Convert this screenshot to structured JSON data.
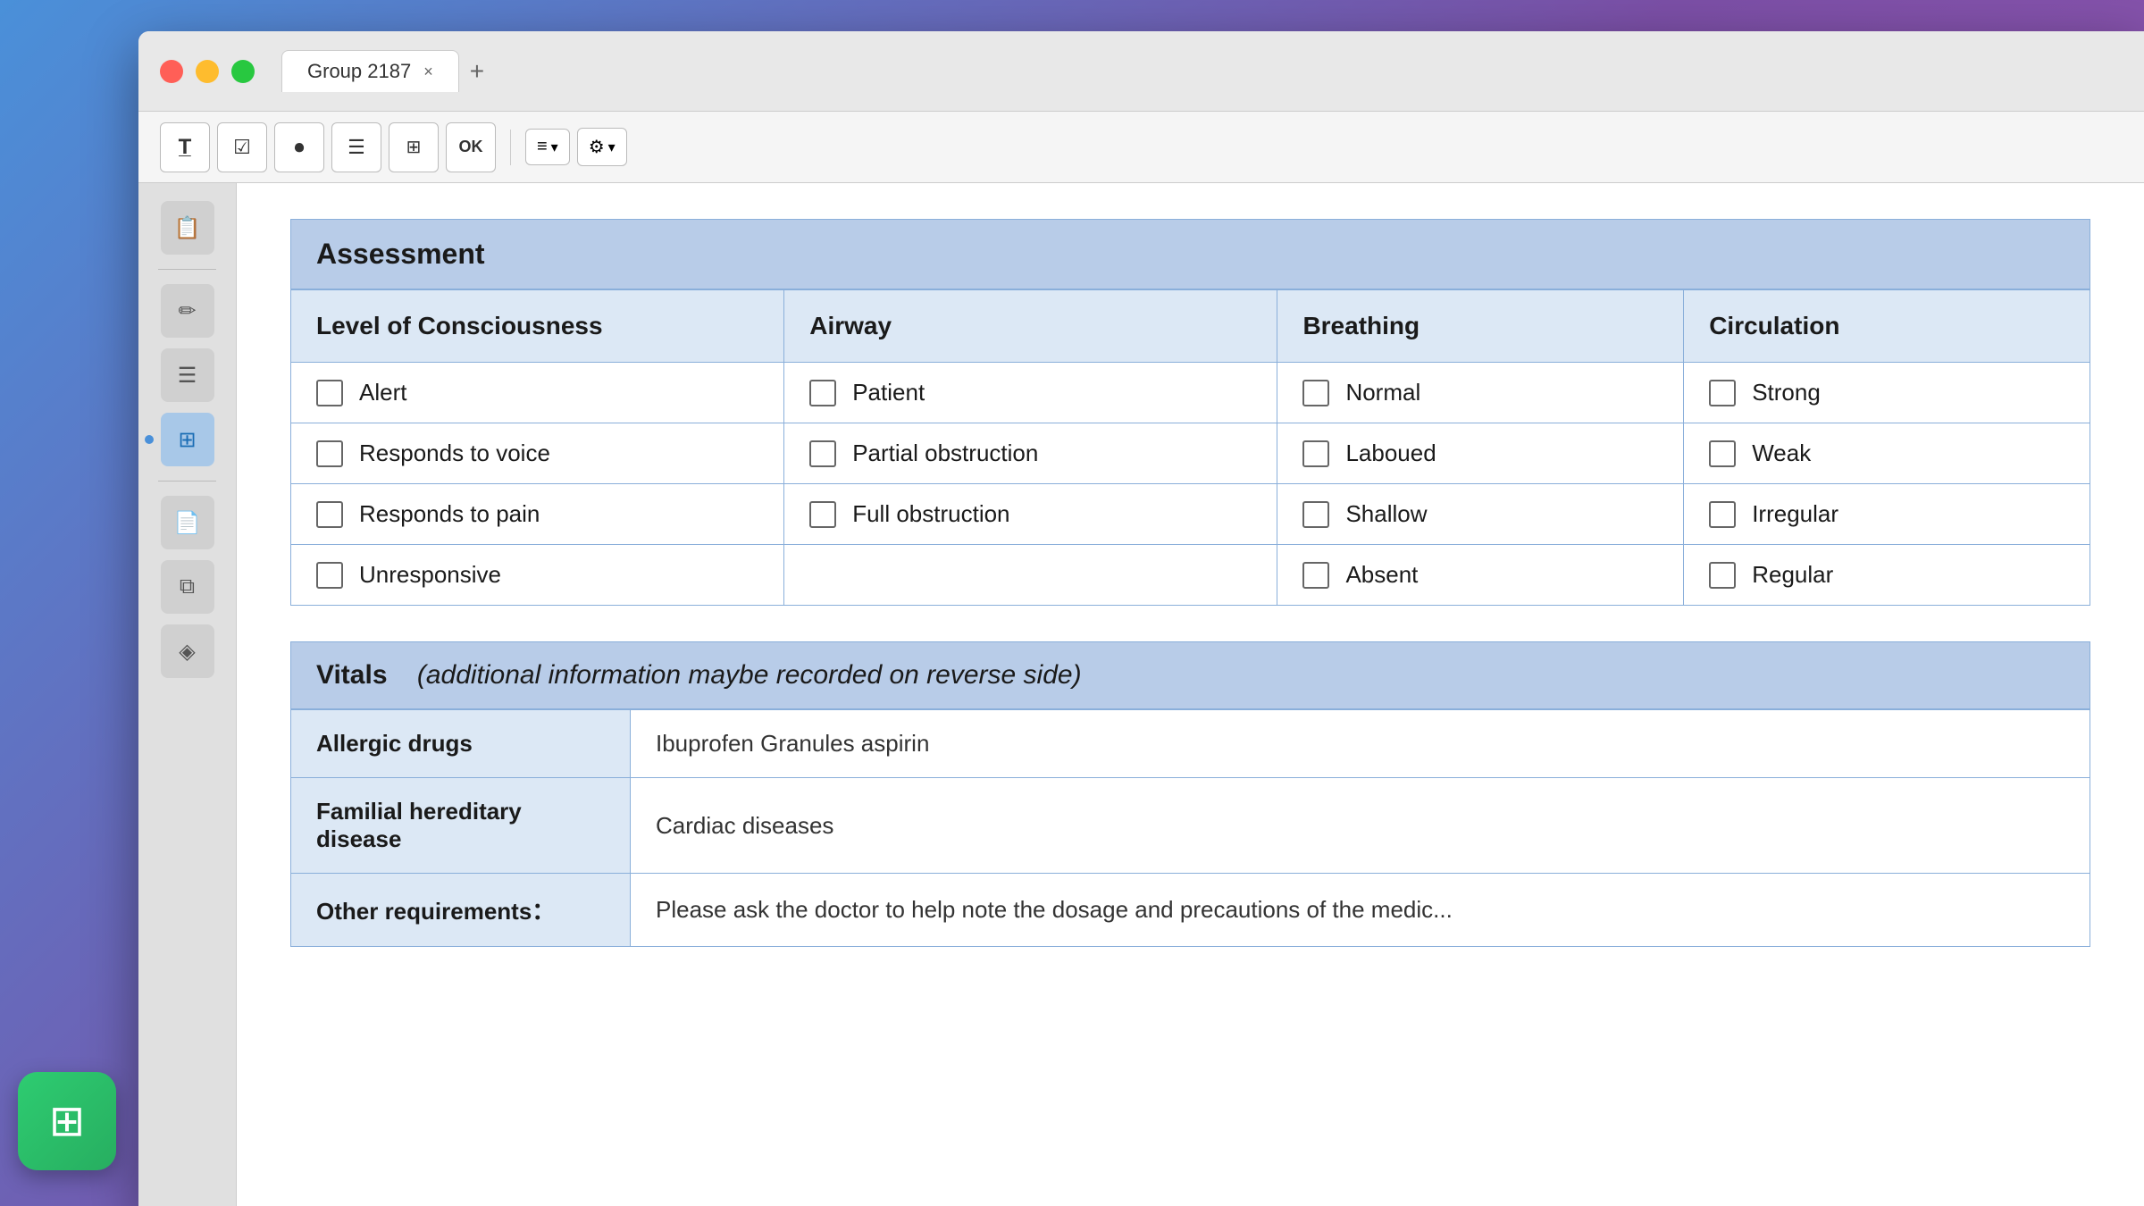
{
  "window": {
    "title": "Group 2187",
    "tab_close": "×",
    "tab_add": "+"
  },
  "traffic_lights": {
    "red": "close",
    "yellow": "minimize",
    "green": "maximize"
  },
  "toolbar": {
    "items": [
      {
        "name": "text-tool",
        "icon": "T̲",
        "label": "Text"
      },
      {
        "name": "checkbox-tool",
        "icon": "☑",
        "label": "Checkbox"
      },
      {
        "name": "record-tool",
        "icon": "⏺",
        "label": "Record"
      },
      {
        "name": "list-tool",
        "icon": "≡",
        "label": "List"
      },
      {
        "name": "table-tool",
        "icon": "⊞",
        "label": "Table"
      },
      {
        "name": "ok-tool",
        "icon": "OK",
        "label": "OK"
      },
      {
        "name": "align-tool",
        "icon": "≡▾",
        "label": "Align"
      },
      {
        "name": "settings-tool",
        "icon": "⚙▾",
        "label": "Settings"
      }
    ]
  },
  "sidebar": {
    "items": [
      {
        "name": "document",
        "icon": "📋"
      },
      {
        "name": "text-editor",
        "icon": "✏"
      },
      {
        "name": "list-view",
        "icon": "≡"
      },
      {
        "name": "grid-view",
        "icon": "⊞",
        "active": true
      },
      {
        "name": "template",
        "icon": "📄"
      },
      {
        "name": "layers",
        "icon": "⧉"
      },
      {
        "name": "components",
        "icon": "◈"
      }
    ]
  },
  "app_icon": "⊞",
  "assessment": {
    "title": "Assessment",
    "columns": [
      {
        "header": "Level of Consciousness",
        "items": [
          "Alert",
          "Responds to voice",
          "Responds to pain",
          "Unresponsive"
        ]
      },
      {
        "header": "Airway",
        "items": [
          "Patient",
          "Partial obstruction",
          "Full obstruction"
        ]
      },
      {
        "header": "Breathing",
        "items": [
          "Normal",
          "Laboued",
          "Shallow",
          "Absent"
        ]
      },
      {
        "header": "Circulation",
        "items": [
          "Strong",
          "Weak",
          "Irregular",
          "Regular"
        ]
      }
    ]
  },
  "vitals": {
    "title": "Vitals",
    "subtitle": "(additional information maybe recorded on reverse side)",
    "rows": [
      {
        "label": "Allergic drugs",
        "value": "Ibuprofen Granules  aspirin"
      },
      {
        "label": "Familial hereditary disease",
        "value": "Cardiac diseases"
      },
      {
        "label": "Other requirements：",
        "value": "Please ask the doctor to help note the dosage and precautions of the medic..."
      }
    ]
  }
}
